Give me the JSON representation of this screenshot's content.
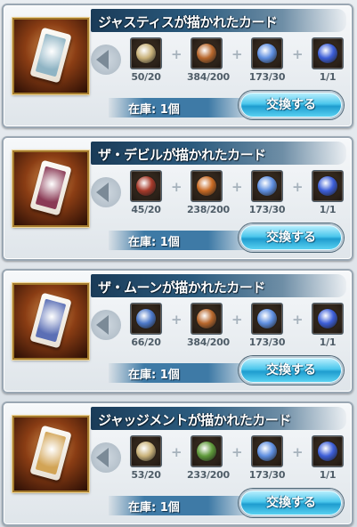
{
  "stock_label": "在庫: ",
  "exchange_label": "交換する",
  "cards": [
    {
      "title": "ジャスティスが描かれたカード",
      "stock": "在庫: 1個",
      "art_color": "#8fb4c4",
      "materials": [
        {
          "icon": "bronze-clock-emblem-icon",
          "count": "50/20",
          "color": "#c9b27a"
        },
        {
          "icon": "red-gold-emblem-icon",
          "count": "384/200",
          "color": "#b8682d"
        },
        {
          "icon": "blue-crystal-icon",
          "count": "173/30",
          "color": "#5f8fe0"
        },
        {
          "icon": "blue-orb-icon",
          "count": "1/1",
          "color": "#3d5fd8"
        }
      ]
    },
    {
      "title": "ザ・デビルが描かれたカード",
      "stock": "在庫: 1個",
      "art_color": "#8a3a55",
      "materials": [
        {
          "icon": "crimson-emblem-icon",
          "count": "45/20",
          "color": "#a63a2a"
        },
        {
          "icon": "orange-gold-emblem-icon",
          "count": "238/200",
          "color": "#c86a24"
        },
        {
          "icon": "blue-crystal-icon",
          "count": "173/30",
          "color": "#5f8fe0"
        },
        {
          "icon": "blue-orb-icon",
          "count": "1/1",
          "color": "#3d5fd8"
        }
      ]
    },
    {
      "title": "ザ・ムーンが描かれたカード",
      "stock": "在庫: 1個",
      "art_color": "#5b6fb5",
      "materials": [
        {
          "icon": "blue-gold-emblem-icon",
          "count": "66/20",
          "color": "#4d79c9"
        },
        {
          "icon": "red-gold-emblem-icon",
          "count": "384/200",
          "color": "#b8682d"
        },
        {
          "icon": "blue-crystal-icon",
          "count": "173/30",
          "color": "#5f8fe0"
        },
        {
          "icon": "blue-orb-icon",
          "count": "1/1",
          "color": "#3d5fd8"
        }
      ]
    },
    {
      "title": "ジャッジメントが描かれたカード",
      "stock": "在庫: 1個",
      "art_color": "#d2a455",
      "materials": [
        {
          "icon": "bronze-clock-emblem-icon",
          "count": "53/20",
          "color": "#c9b27a"
        },
        {
          "icon": "green-emblem-icon",
          "count": "233/200",
          "color": "#5f9a3a"
        },
        {
          "icon": "blue-crystal-icon",
          "count": "173/30",
          "color": "#5f8fe0"
        },
        {
          "icon": "blue-orb-icon",
          "count": "1/1",
          "color": "#3d5fd8"
        }
      ]
    }
  ]
}
